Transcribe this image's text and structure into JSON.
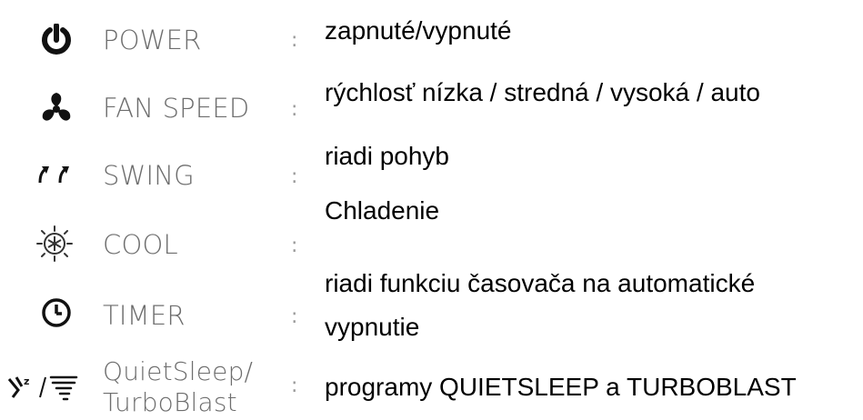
{
  "rows": [
    {
      "icon": "power-icon",
      "label": "POWER",
      "colon": ":",
      "desc": "zapnuté/vypnuté"
    },
    {
      "icon": "fan-icon",
      "label": "FAN SPEED",
      "colon": ":",
      "desc": "rýchlosť nízka / stredná / vysoká / auto"
    },
    {
      "icon": "swing-icon",
      "label": "SWING",
      "colon": ":",
      "desc": "riadi pohyb"
    },
    {
      "icon": "snowflake-sun-icon",
      "label": "COOL",
      "colon": ":",
      "desc": "Chladenie"
    },
    {
      "icon": "clock-icon",
      "label": "TIMER",
      "colon": ":",
      "desc_line1": "riadi funkciu časovača na automatické",
      "desc_line2": "vypnutie"
    },
    {
      "icon": "quietsleep-turboblast-icon",
      "label_line1": "QuietSleep/",
      "label_line2": "TurboBlast",
      "colon": ":",
      "desc": "programy QUIETSLEEP a TURBOBLAST"
    }
  ]
}
